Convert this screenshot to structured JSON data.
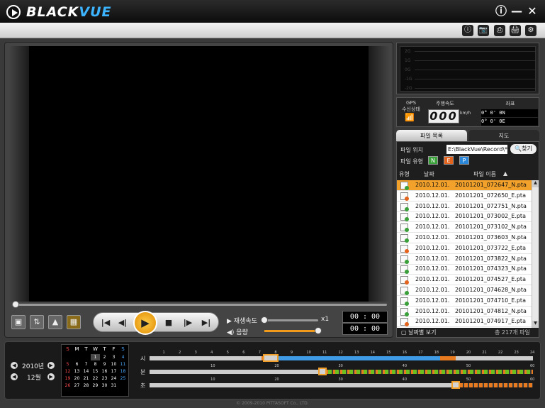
{
  "app": {
    "brand1": "BLACK",
    "brand2": "VUE"
  },
  "window": {
    "info": "ⓘ",
    "minimize": "—",
    "close": "✕"
  },
  "toolbar": [
    "ⓘ",
    "📷",
    "⎙",
    "🖨",
    "⚙"
  ],
  "player": {
    "speed_label": "재생속도",
    "volume_label": "음량",
    "speed_value": "x1",
    "time_current": "00 : 00",
    "time_total": "00 : 00",
    "buttons": {
      "first": "|◀",
      "prev": "◀|",
      "play": "▶",
      "stop": "■",
      "next": "|▶",
      "last": "▶|"
    },
    "seek_progress": 0,
    "speed_level": 0,
    "volume_level": 1
  },
  "gsensor": {
    "labels": [
      "2G",
      "1G",
      "0G",
      "-1G",
      "-2G"
    ]
  },
  "gps": {
    "status_label1": "GPS",
    "status_label2": "수신상태",
    "speed_label": "주행속도",
    "speed_value": "000",
    "unit": "km/h",
    "coord_label": "좌표",
    "lat": "0°  0'         0N",
    "lon": "0°  0'         0E"
  },
  "tabs": {
    "files": "파일 목록",
    "map": "지도"
  },
  "filepanel": {
    "location_label": "파일 위치",
    "location_value": "E:\\BlackVue\\Record\\*.*",
    "find_button": "찾기",
    "type_label": "파일 유형",
    "types": [
      "N",
      "E",
      "P"
    ],
    "col_type": "유형",
    "col_date": "날짜",
    "col_name": "파일 이름",
    "sort_icon": "▲",
    "files": [
      {
        "type": "N",
        "date": "2010.12.01.",
        "name": "20101201_072647_N.pta",
        "selected": true
      },
      {
        "type": "E",
        "date": "2010.12.01.",
        "name": "20101201_072650_E.pta"
      },
      {
        "type": "N",
        "date": "2010.12.01.",
        "name": "20101201_072751_N.pta"
      },
      {
        "type": "N",
        "date": "2010.12.01.",
        "name": "20101201_073002_E.pta"
      },
      {
        "type": "N",
        "date": "2010.12.01.",
        "name": "20101201_073102_N.pta"
      },
      {
        "type": "N",
        "date": "2010.12.01.",
        "name": "20101201_073603_N.pta"
      },
      {
        "type": "E",
        "date": "2010.12.01.",
        "name": "20101201_073722_E.pta"
      },
      {
        "type": "N",
        "date": "2010.12.01.",
        "name": "20101201_073822_N.pta"
      },
      {
        "type": "N",
        "date": "2010.12.01.",
        "name": "20101201_074323_N.pta"
      },
      {
        "type": "E",
        "date": "2010.12.01.",
        "name": "20101201_074527_E.pta"
      },
      {
        "type": "N",
        "date": "2010.12.01.",
        "name": "20101201_074628_N.pta"
      },
      {
        "type": "N",
        "date": "2010.12.01.",
        "name": "20101201_074710_E.pta"
      },
      {
        "type": "N",
        "date": "2010.12.01.",
        "name": "20101201_074812_N.pta"
      },
      {
        "type": "E",
        "date": "2010.12.01.",
        "name": "20101201_074917_E.pta"
      }
    ],
    "footer_label": "날짜별 보기",
    "count_label": "총 217개 파일"
  },
  "calendar": {
    "year": "2010년",
    "month": "12월",
    "weekdays": [
      "S",
      "M",
      "T",
      "W",
      "T",
      "F",
      "S"
    ],
    "days": [
      [
        "",
        "",
        "",
        "1",
        "2",
        "3",
        "4"
      ],
      [
        "5",
        "6",
        "7",
        "8",
        "9",
        "10",
        "11"
      ],
      [
        "12",
        "13",
        "14",
        "15",
        "16",
        "17",
        "18"
      ],
      [
        "19",
        "20",
        "21",
        "22",
        "23",
        "24",
        "25"
      ],
      [
        "26",
        "27",
        "28",
        "29",
        "30",
        "31",
        ""
      ]
    ]
  },
  "timeline": {
    "hour_label": "시",
    "min_label": "분",
    "sec_label": "초",
    "hour_ticks": [
      "1",
      "2",
      "3",
      "4",
      "5",
      "6",
      "7",
      "8",
      "9",
      "10",
      "11",
      "12",
      "13",
      "14",
      "15",
      "16",
      "17",
      "18",
      "19",
      "20",
      "21",
      "22",
      "23",
      "24"
    ],
    "min_ticks": [
      "10",
      "20",
      "30",
      "40",
      "50",
      "60"
    ],
    "sec_ticks": [
      "10",
      "20",
      "30",
      "40",
      "50",
      "60"
    ],
    "colors": {
      "normal": "#3f9be6",
      "event": "#e87a1f",
      "green": "#6bbf1f"
    }
  },
  "copyright": "© 2009-2010 PITTASOFT Co., LTD."
}
